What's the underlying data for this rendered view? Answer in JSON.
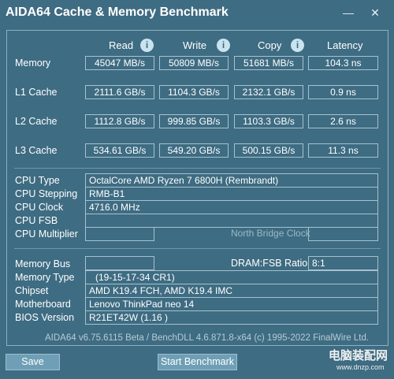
{
  "window": {
    "title": "AIDA64 Cache & Memory Benchmark",
    "minimize_glyph": "—",
    "close_glyph": "✕"
  },
  "columns": {
    "read": "Read",
    "write": "Write",
    "copy": "Copy",
    "latency": "Latency",
    "info_glyph": "i"
  },
  "benchmark_rows": [
    {
      "label": "Memory",
      "read": "45047 MB/s",
      "write": "50809 MB/s",
      "copy": "51681 MB/s",
      "latency": "104.3 ns"
    },
    {
      "label": "L1 Cache",
      "read": "2111.6 GB/s",
      "write": "1104.3 GB/s",
      "copy": "2132.1 GB/s",
      "latency": "0.9 ns"
    },
    {
      "label": "L2 Cache",
      "read": "1112.8 GB/s",
      "write": "999.85 GB/s",
      "copy": "1103.3 GB/s",
      "latency": "2.6 ns"
    },
    {
      "label": "L3 Cache",
      "read": "534.61 GB/s",
      "write": "549.20 GB/s",
      "copy": "500.15 GB/s",
      "latency": "11.3 ns"
    }
  ],
  "cpu": {
    "type_label": "CPU Type",
    "type_value": "OctalCore AMD Ryzen 7 6800H  (Rembrandt)",
    "stepping_label": "CPU Stepping",
    "stepping_value": "RMB-B1",
    "clock_label": "CPU Clock",
    "clock_value": "4716.0 MHz",
    "fsb_label": "CPU FSB",
    "fsb_value": "",
    "multiplier_label": "CPU Multiplier",
    "multiplier_value": "",
    "north_bridge_label": "North Bridge Clock",
    "north_bridge_value": ""
  },
  "memory": {
    "bus_label": "Memory Bus",
    "bus_value": "",
    "ratio_label": "DRAM:FSB Ratio",
    "ratio_value": "8:1",
    "type_label": "Memory Type",
    "type_value": "(19-15-17-34 CR1)",
    "chipset_label": "Chipset",
    "chipset_value": "AMD K19.4 FCH, AMD K19.4 IMC",
    "motherboard_label": "Motherboard",
    "motherboard_value": "Lenovo ThinkPad neo 14",
    "bios_label": "BIOS Version",
    "bios_value": "R21ET42W (1.16 )"
  },
  "footer": {
    "version_text": "AIDA64 v6.75.6115 Beta / BenchDLL 4.6.871.8-x64  (c) 1995-2022 FinalWire Ltd."
  },
  "buttons": {
    "save": "Save",
    "start": "Start Benchmark"
  },
  "watermark": {
    "text": "电脑装配网",
    "sub": "www.dnzp.com"
  },
  "colors": {
    "background": "#3e6c82",
    "border": "#a6c2d0",
    "button": "#6f9fb6"
  }
}
